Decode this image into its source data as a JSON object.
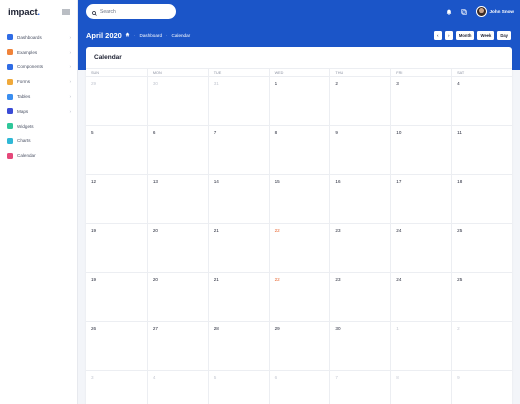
{
  "app": {
    "logo_text": "impact",
    "logo_dot": "."
  },
  "sidebar": {
    "items": [
      {
        "label": "Dashboards",
        "icon": "dashboard-icon",
        "color": "#2f6ce5",
        "has_chevron": true
      },
      {
        "label": "Examples",
        "icon": "examples-icon",
        "color": "#f0833a",
        "has_chevron": true
      },
      {
        "label": "Components",
        "icon": "components-icon",
        "color": "#2f6ce5",
        "has_chevron": true
      },
      {
        "label": "Forms",
        "icon": "forms-icon",
        "color": "#f0a93a",
        "has_chevron": true
      },
      {
        "label": "Tables",
        "icon": "tables-icon",
        "color": "#3a8ef0",
        "has_chevron": true
      },
      {
        "label": "Maps",
        "icon": "maps-icon",
        "color": "#3a4bd6",
        "has_chevron": true
      },
      {
        "label": "Widgets",
        "icon": "widgets-icon",
        "color": "#2fc79a",
        "has_chevron": false
      },
      {
        "label": "Charts",
        "icon": "charts-icon",
        "color": "#2fb8d6",
        "has_chevron": false
      },
      {
        "label": "Calendar",
        "icon": "calendar-icon",
        "color": "#e5487a",
        "has_chevron": false
      }
    ],
    "chevron": "›"
  },
  "header": {
    "search_placeholder": "Search",
    "user_name": "John Snow",
    "page_title": "April 2020",
    "breadcrumbs": [
      "Dashboard",
      "Calendar"
    ],
    "buttons": {
      "prev": "‹",
      "next": "›",
      "month": "Month",
      "week": "Week",
      "day": "Day"
    },
    "accent_color": "#1b55c8"
  },
  "calendar": {
    "card_title": "Calendar",
    "weekdays": [
      "SUN",
      "MON",
      "TUE",
      "WED",
      "THU",
      "FRI",
      "SAT"
    ],
    "weeks": [
      [
        {
          "d": "29",
          "m": true
        },
        {
          "d": "30",
          "m": true
        },
        {
          "d": "31",
          "m": true
        },
        {
          "d": "1"
        },
        {
          "d": "2"
        },
        {
          "d": "3"
        },
        {
          "d": "4"
        }
      ],
      [
        {
          "d": "5"
        },
        {
          "d": "6"
        },
        {
          "d": "7"
        },
        {
          "d": "8"
        },
        {
          "d": "9"
        },
        {
          "d": "10"
        },
        {
          "d": "11"
        }
      ],
      [
        {
          "d": "12"
        },
        {
          "d": "13"
        },
        {
          "d": "14"
        },
        {
          "d": "15"
        },
        {
          "d": "16"
        },
        {
          "d": "17"
        },
        {
          "d": "18"
        }
      ],
      [
        {
          "d": "19"
        },
        {
          "d": "20"
        },
        {
          "d": "21"
        },
        {
          "d": "22",
          "t": true
        },
        {
          "d": "23"
        },
        {
          "d": "24"
        },
        {
          "d": "25"
        }
      ],
      [
        {
          "d": "19"
        },
        {
          "d": "20"
        },
        {
          "d": "21"
        },
        {
          "d": "22",
          "t": true
        },
        {
          "d": "23"
        },
        {
          "d": "24"
        },
        {
          "d": "25"
        }
      ],
      [
        {
          "d": "26"
        },
        {
          "d": "27"
        },
        {
          "d": "28"
        },
        {
          "d": "29"
        },
        {
          "d": "30"
        },
        {
          "d": "1",
          "m": true
        },
        {
          "d": "2",
          "m": true
        }
      ],
      [
        {
          "d": "3",
          "m": true
        },
        {
          "d": "4",
          "m": true
        },
        {
          "d": "5",
          "m": true
        },
        {
          "d": "6",
          "m": true
        },
        {
          "d": "7",
          "m": true
        },
        {
          "d": "8",
          "m": true
        },
        {
          "d": "9",
          "m": true
        }
      ]
    ]
  }
}
